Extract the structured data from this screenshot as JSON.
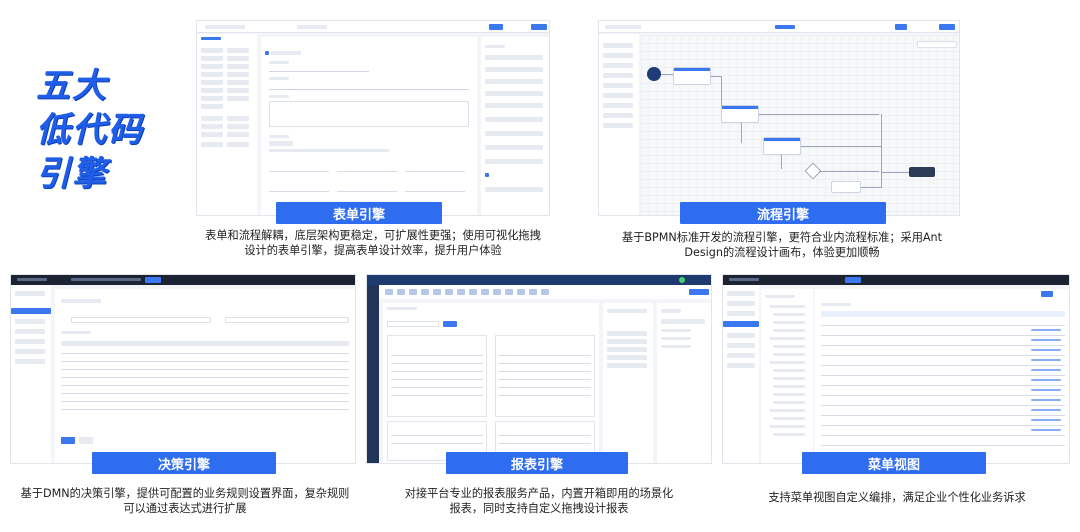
{
  "hero": {
    "lines": [
      "五大",
      "低代码",
      "引擎"
    ]
  },
  "panels": {
    "form": {
      "label": "表单引擎",
      "desc": [
        "表单和流程解耦，底层架构更稳定，可扩展性更强；使用可视化拖拽",
        "设计的表单引擎，提高表单设计效率，提升用户体验"
      ]
    },
    "flow": {
      "label": "流程引擎",
      "desc": [
        "基于BPMN标准开发的流程引擎，更符合业内流程标准；采用Ant",
        "Design的流程设计画布，体验更加顺畅"
      ]
    },
    "decision": {
      "label": "决策引擎",
      "desc": [
        "基于DMN的决策引擎，提供可配置的业务规则设置界面，复杂规则",
        "可以通过表达式进行扩展"
      ]
    },
    "report": {
      "label": "报表引擎",
      "desc": [
        "对接平台专业的报表服务产品，内置开箱即用的场景化",
        "报表，同时支持自定义拖拽设计报表"
      ]
    },
    "menu": {
      "label": "菜单视图",
      "desc": [
        "支持菜单视图自定义编排，满足企业个性化业务诉求"
      ]
    }
  },
  "colors": {
    "accent": "#2f6df0",
    "title": "#1f5ee8",
    "darkbar": "#1c2433"
  }
}
